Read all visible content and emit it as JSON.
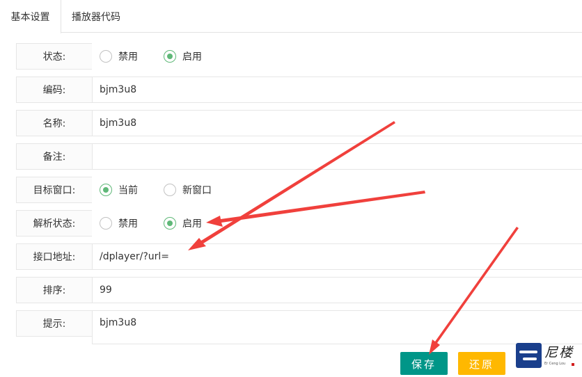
{
  "tabs": [
    "基本设置",
    "播放器代码"
  ],
  "form": {
    "status": {
      "label": "状态:",
      "options": [
        "禁用",
        "启用"
      ],
      "selected": "启用"
    },
    "code": {
      "label": "编码:",
      "value": "bjm3u8"
    },
    "name": {
      "label": "名称:",
      "value": "bjm3u8"
    },
    "remark": {
      "label": "备注:",
      "value": ""
    },
    "target": {
      "label": "目标窗口:",
      "options": [
        "当前",
        "新窗口"
      ],
      "selected": "当前"
    },
    "parse_status": {
      "label": "解析状态:",
      "options": [
        "禁用",
        "启用"
      ],
      "selected": "启用"
    },
    "api_url": {
      "label": "接口地址:",
      "value": "/dplayer/?url="
    },
    "sort": {
      "label": "排序:",
      "value": "99"
    },
    "tip": {
      "label": "提示:",
      "value": "bjm3u8"
    }
  },
  "buttons": {
    "save": "保存",
    "reset": "还原"
  },
  "logo": {
    "text": "尼楼",
    "sub": "Er Ceng Lou"
  },
  "colors": {
    "radio_checked": "#5fb878",
    "save_button": "#009688",
    "reset_button": "#ffb800",
    "annotation_arrow": "#f0403c",
    "logo_blue": "#1a3f8c"
  }
}
